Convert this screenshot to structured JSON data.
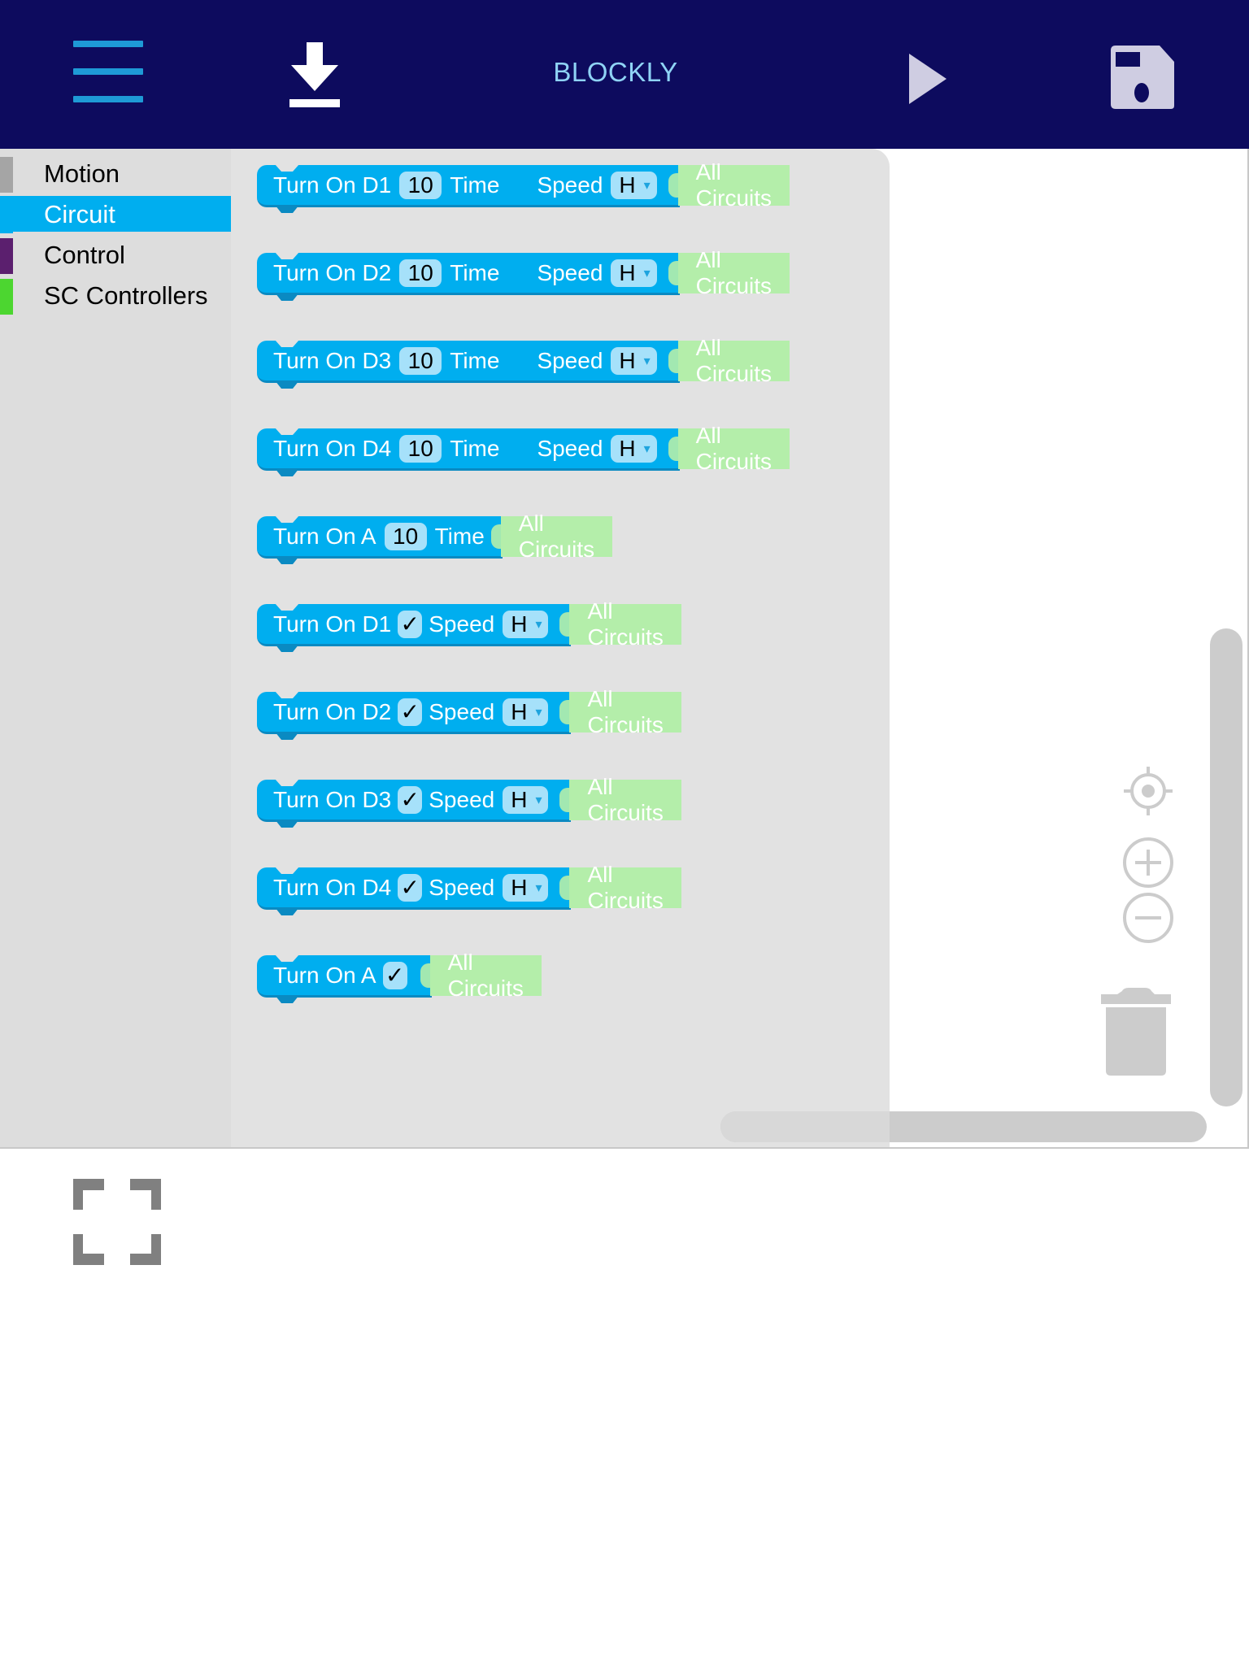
{
  "topbar": {
    "title": "BLOCKLY",
    "icons": {
      "menu": "hamburger-menu-icon",
      "download": "download-icon",
      "run": "play-icon",
      "save": "floppy-disk-icon"
    },
    "colors": {
      "background": "#0d0b5e",
      "title": "#8fd3f5",
      "menu_lines": "#1e9ad6"
    }
  },
  "toolbox": {
    "categories": [
      {
        "label": "Motion",
        "color": "#a5a5a5",
        "selected": false
      },
      {
        "label": "Circuit",
        "color": "#00aeef",
        "selected": true
      },
      {
        "label": "Control",
        "color": "#5b1f6e",
        "selected": false
      },
      {
        "label": "SC Controllers",
        "color": "#4cd630",
        "selected": false
      }
    ]
  },
  "flyout": {
    "block_color": "#00aeef",
    "field_color": "#a6e1fa",
    "circuits_color": "#b4eeaa",
    "blocks": [
      {
        "prefix": "Turn On D1",
        "value": "10",
        "time_label": "Time",
        "speed_label": "Speed",
        "speed": "H",
        "target": "All Circuits"
      },
      {
        "prefix": "Turn On D2",
        "value": "10",
        "time_label": "Time",
        "speed_label": "Speed",
        "speed": "H",
        "target": "All Circuits"
      },
      {
        "prefix": "Turn On D3",
        "value": "10",
        "time_label": "Time",
        "speed_label": "Speed",
        "speed": "H",
        "target": "All Circuits"
      },
      {
        "prefix": "Turn On D4",
        "value": "10",
        "time_label": "Time",
        "speed_label": "Speed",
        "speed": "H",
        "target": "All Circuits"
      },
      {
        "prefix": "Turn On A",
        "value": "10",
        "time_label": "Time",
        "target": "All Circuits"
      },
      {
        "prefix": "Turn On D1",
        "checked": "✓",
        "speed_label": "Speed",
        "speed": "H",
        "target": "All Circuits"
      },
      {
        "prefix": "Turn On D2",
        "checked": "✓",
        "speed_label": "Speed",
        "speed": "H",
        "target": "All Circuits"
      },
      {
        "prefix": "Turn On D3",
        "checked": "✓",
        "speed_label": "Speed",
        "speed": "H",
        "target": "All Circuits"
      },
      {
        "prefix": "Turn On D4",
        "checked": "✓",
        "speed_label": "Speed",
        "speed": "H",
        "target": "All Circuits"
      },
      {
        "prefix": "Turn On A",
        "checked": "✓",
        "target": "All Circuits"
      }
    ],
    "dropdown_arrow": "▾"
  },
  "workspace_controls": {
    "recenter": "crosshair-target-icon",
    "zoom_in": "zoom-in-icon",
    "zoom_out": "zoom-out-icon",
    "trash": "trash-icon"
  },
  "footer": {
    "fullscreen": "fullscreen-icon"
  }
}
